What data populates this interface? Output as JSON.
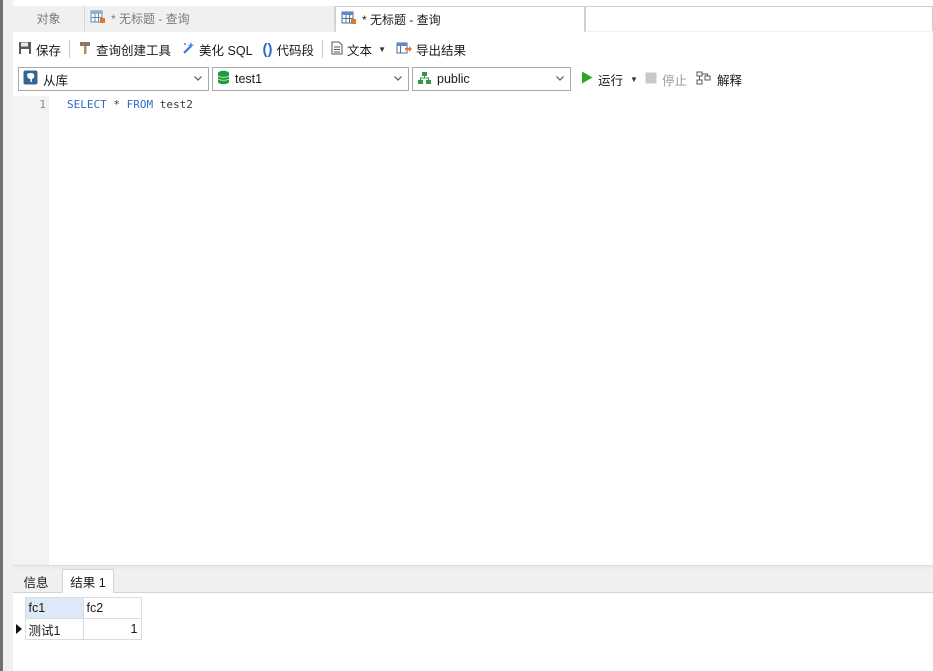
{
  "tabs": [
    {
      "label": "对象"
    },
    {
      "label": "* 无标题 - 查询"
    },
    {
      "label": "* 无标题 - 查询"
    }
  ],
  "toolbar": {
    "save": "保存",
    "query_builder": "查询创建工具",
    "beautify": "美化 SQL",
    "code_snippet": "代码段",
    "text": "文本",
    "export": "导出结果"
  },
  "selectors": {
    "connection": "从库",
    "database": "test1",
    "schema": "public"
  },
  "run": {
    "run": "运行",
    "stop": "停止",
    "explain": "解释"
  },
  "editor": {
    "line_number": "1",
    "kw_select": "SELECT",
    "star": " * ",
    "kw_from": "FROM",
    "table": " test2"
  },
  "bottom_tabs": {
    "info": "信息",
    "result": "结果 1"
  },
  "result": {
    "columns": [
      "fc1",
      "fc2"
    ],
    "rows": [
      [
        "测试1",
        "1"
      ]
    ]
  },
  "colors": {
    "keyword": "#2d6cc5",
    "run_green": "#2aa52a",
    "db_green": "#1e9e3a"
  }
}
